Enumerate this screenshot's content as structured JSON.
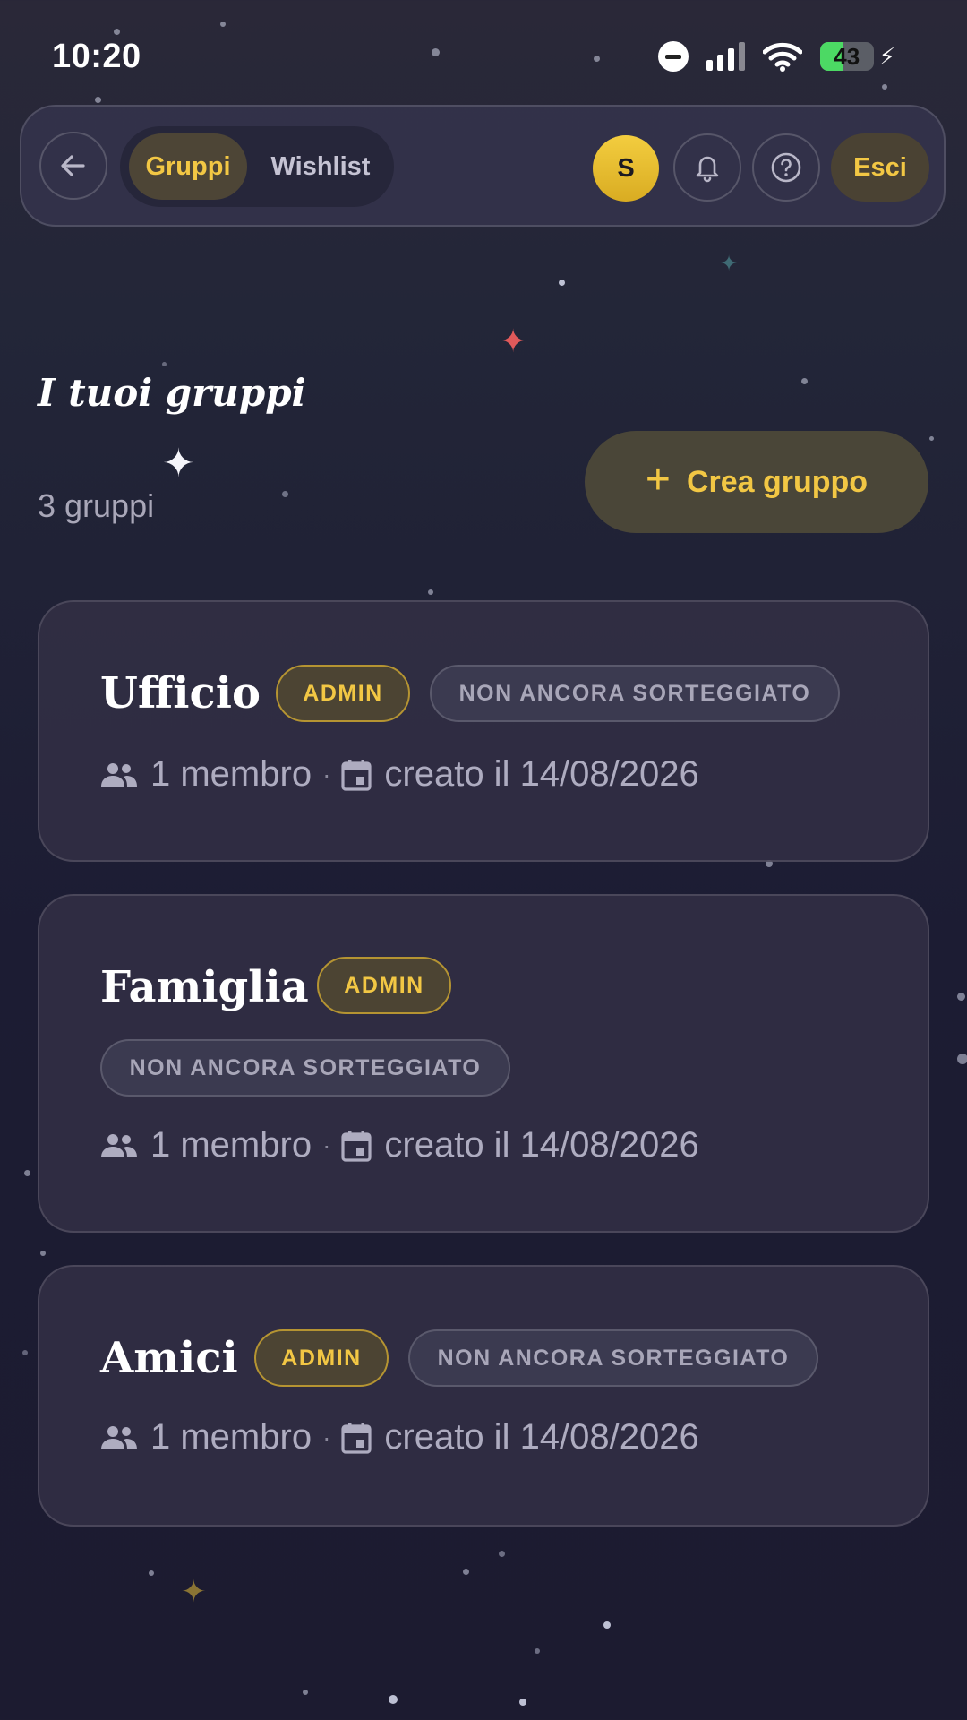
{
  "status_bar": {
    "time": "10:20",
    "battery": "43",
    "battery_level": 0.43
  },
  "nav": {
    "tabs": [
      {
        "label": "Gruppi",
        "active": true
      },
      {
        "label": "Wishlist",
        "active": false
      }
    ],
    "avatar_initial": "S",
    "logout_label": "Esci",
    "icons": [
      "arrow-left-icon",
      "bell-icon",
      "question-icon"
    ]
  },
  "header": {
    "title": "I tuoi gruppi",
    "count": "3 gruppi",
    "create_label": "Crea gruppo"
  },
  "groups": [
    {
      "name": "Ufficio",
      "role": "ADMIN",
      "status": "NON ANCORA SORTEGGIATO",
      "members": "1 membro",
      "created": "creato il 14/08/2026"
    },
    {
      "name": "Famiglia",
      "role": "ADMIN",
      "status": "NON ANCORA SORTEGGIATO",
      "members": "1 membro",
      "created": "creato il 14/08/2026"
    },
    {
      "name": "Amici",
      "role": "ADMIN",
      "status": "NON ANCORA SORTEGGIATO",
      "members": "1 membro",
      "created": "creato il 14/08/2026"
    }
  ],
  "colors": {
    "accent": "#f2c744",
    "background": "#1c1b30",
    "card": "#322f44",
    "battery": "#4cd964"
  }
}
